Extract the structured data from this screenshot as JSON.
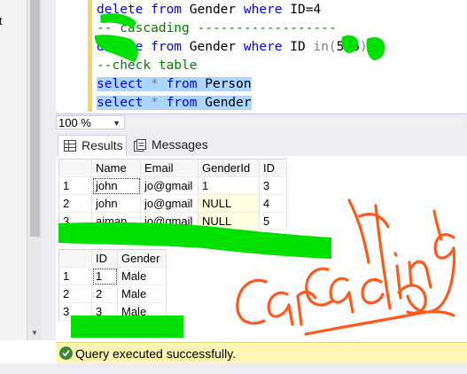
{
  "left_panel": {
    "cut_text": "t"
  },
  "editor": {
    "lines": [
      {
        "parts": [
          [
            "kw",
            "delete "
          ],
          [
            "kw",
            "from "
          ],
          [
            "tx",
            "Gender "
          ],
          [
            "kw",
            "where "
          ],
          [
            "tx",
            "ID=4"
          ]
        ]
      },
      {
        "parts": [
          [
            "cm",
            "-- cascading ------------------"
          ]
        ]
      },
      {
        "parts": [
          [
            "kw",
            "delete "
          ],
          [
            "kw",
            "from "
          ],
          [
            "tx",
            "Gender "
          ],
          [
            "kw",
            "where "
          ],
          [
            "tx",
            "ID "
          ],
          [
            "gray",
            "in("
          ],
          [
            "tx",
            "5,6"
          ],
          [
            "gray",
            ")"
          ]
        ]
      },
      {
        "parts": [
          [
            "cm",
            "--check table"
          ]
        ]
      },
      {
        "parts": [
          [
            "kw",
            "select "
          ],
          [
            "gray",
            "* "
          ],
          [
            "kw",
            "from "
          ],
          [
            "tx",
            "Person"
          ]
        ],
        "selected": true
      },
      {
        "parts": [
          [
            "kw",
            "select "
          ],
          [
            "gray",
            "* "
          ],
          [
            "kw",
            "from "
          ],
          [
            "tx",
            "Gender"
          ]
        ],
        "selected": true
      }
    ]
  },
  "zoom": {
    "value": "100 %"
  },
  "tabs": {
    "results_label": "Results",
    "messages_label": "Messages"
  },
  "person_grid": {
    "columns": [
      "",
      "Name",
      "Email",
      "GenderId",
      "ID"
    ],
    "rows": [
      [
        "1",
        "john",
        "jo@gmail",
        "1",
        "3"
      ],
      [
        "2",
        "john",
        "jo@gmail",
        "NULL",
        "4"
      ],
      [
        "3",
        "ajman",
        "jo@gmail",
        "NULL",
        "5"
      ]
    ]
  },
  "gender_grid": {
    "columns": [
      "",
      "ID",
      "Gender"
    ],
    "rows": [
      [
        "1",
        "1",
        "Male"
      ],
      [
        "2",
        "2",
        "Male"
      ],
      [
        "3",
        "3",
        "Male"
      ]
    ]
  },
  "status": {
    "message": "Query executed successfully."
  },
  "colors": {
    "highlighter": "#00e000",
    "ink": "#ff5a1e",
    "selection": "#add6ff",
    "status_bg": "#fff7b3"
  }
}
